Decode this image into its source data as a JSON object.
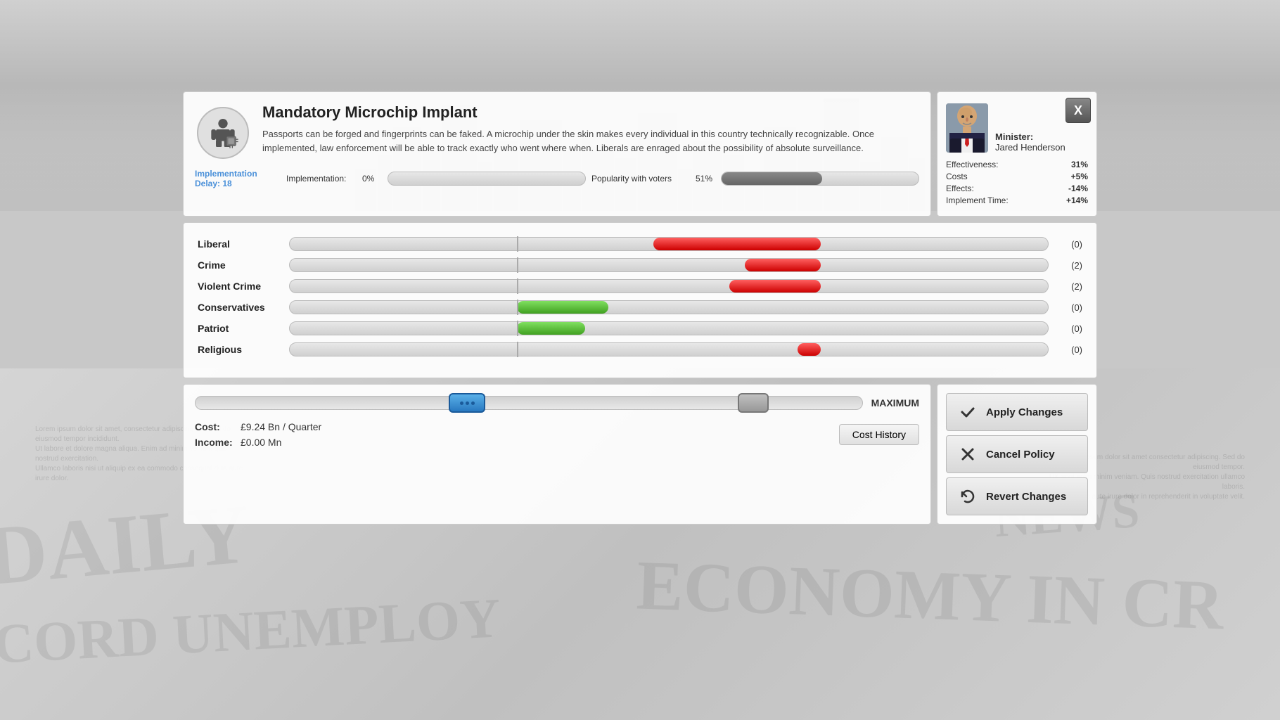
{
  "background": {
    "top_gradient_start": "#d0d0d0",
    "top_gradient_end": "#c5c5c5"
  },
  "policy": {
    "title": "Mandatory Microchip Implant",
    "description": "Passports can be forged and fingerprints can be faked. A microchip under the skin makes every individual in this country technically recognizable. Once implemented, law enforcement will be able to track exactly who went where when. Liberals are enraged about the possibility of absolute surveillance.",
    "implementation_label": "Implementation Delay: 18",
    "implementation_bar_label": "Implementation:",
    "implementation_percent": "0%",
    "popularity_label": "Popularity with voters",
    "popularity_percent": "51%"
  },
  "minister": {
    "label": "Minister:",
    "name": "Jared Henderson",
    "effectiveness_label": "Effectiveness:",
    "effectiveness_value": "31%",
    "costs_label": "Costs",
    "costs_value": "+5%",
    "effects_label": "Effects:",
    "effects_value": "-14%",
    "implement_time_label": "Implement Time:",
    "implement_time_value": "+14%"
  },
  "close_button": "X",
  "effects": {
    "rows": [
      {
        "label": "Liberal",
        "value": "(0)",
        "type": "red-large"
      },
      {
        "label": "Crime",
        "value": "(2)",
        "type": "red-medium"
      },
      {
        "label": "Violent Crime",
        "value": "(2)",
        "type": "red-medium"
      },
      {
        "label": "Conservatives",
        "value": "(0)",
        "type": "green-medium"
      },
      {
        "label": "Patriot",
        "value": "(0)",
        "type": "green-small"
      },
      {
        "label": "Religious",
        "value": "(0)",
        "type": "red-tiny"
      }
    ]
  },
  "slider": {
    "maximum_label": "MAXIMUM"
  },
  "cost": {
    "label": "Cost:",
    "value": "£9.24 Bn / Quarter"
  },
  "income": {
    "label": "Income:",
    "value": "£0.00 Mn"
  },
  "buttons": {
    "cost_history": "Cost History",
    "apply_changes": "Apply Changes",
    "cancel_policy": "Cancel Policy",
    "revert_changes": "Revert Changes"
  },
  "newspaper_headlines": [
    "DAILY",
    "CORD UNEMPLOY",
    "NEWS",
    "ECONOMY IN CR"
  ]
}
